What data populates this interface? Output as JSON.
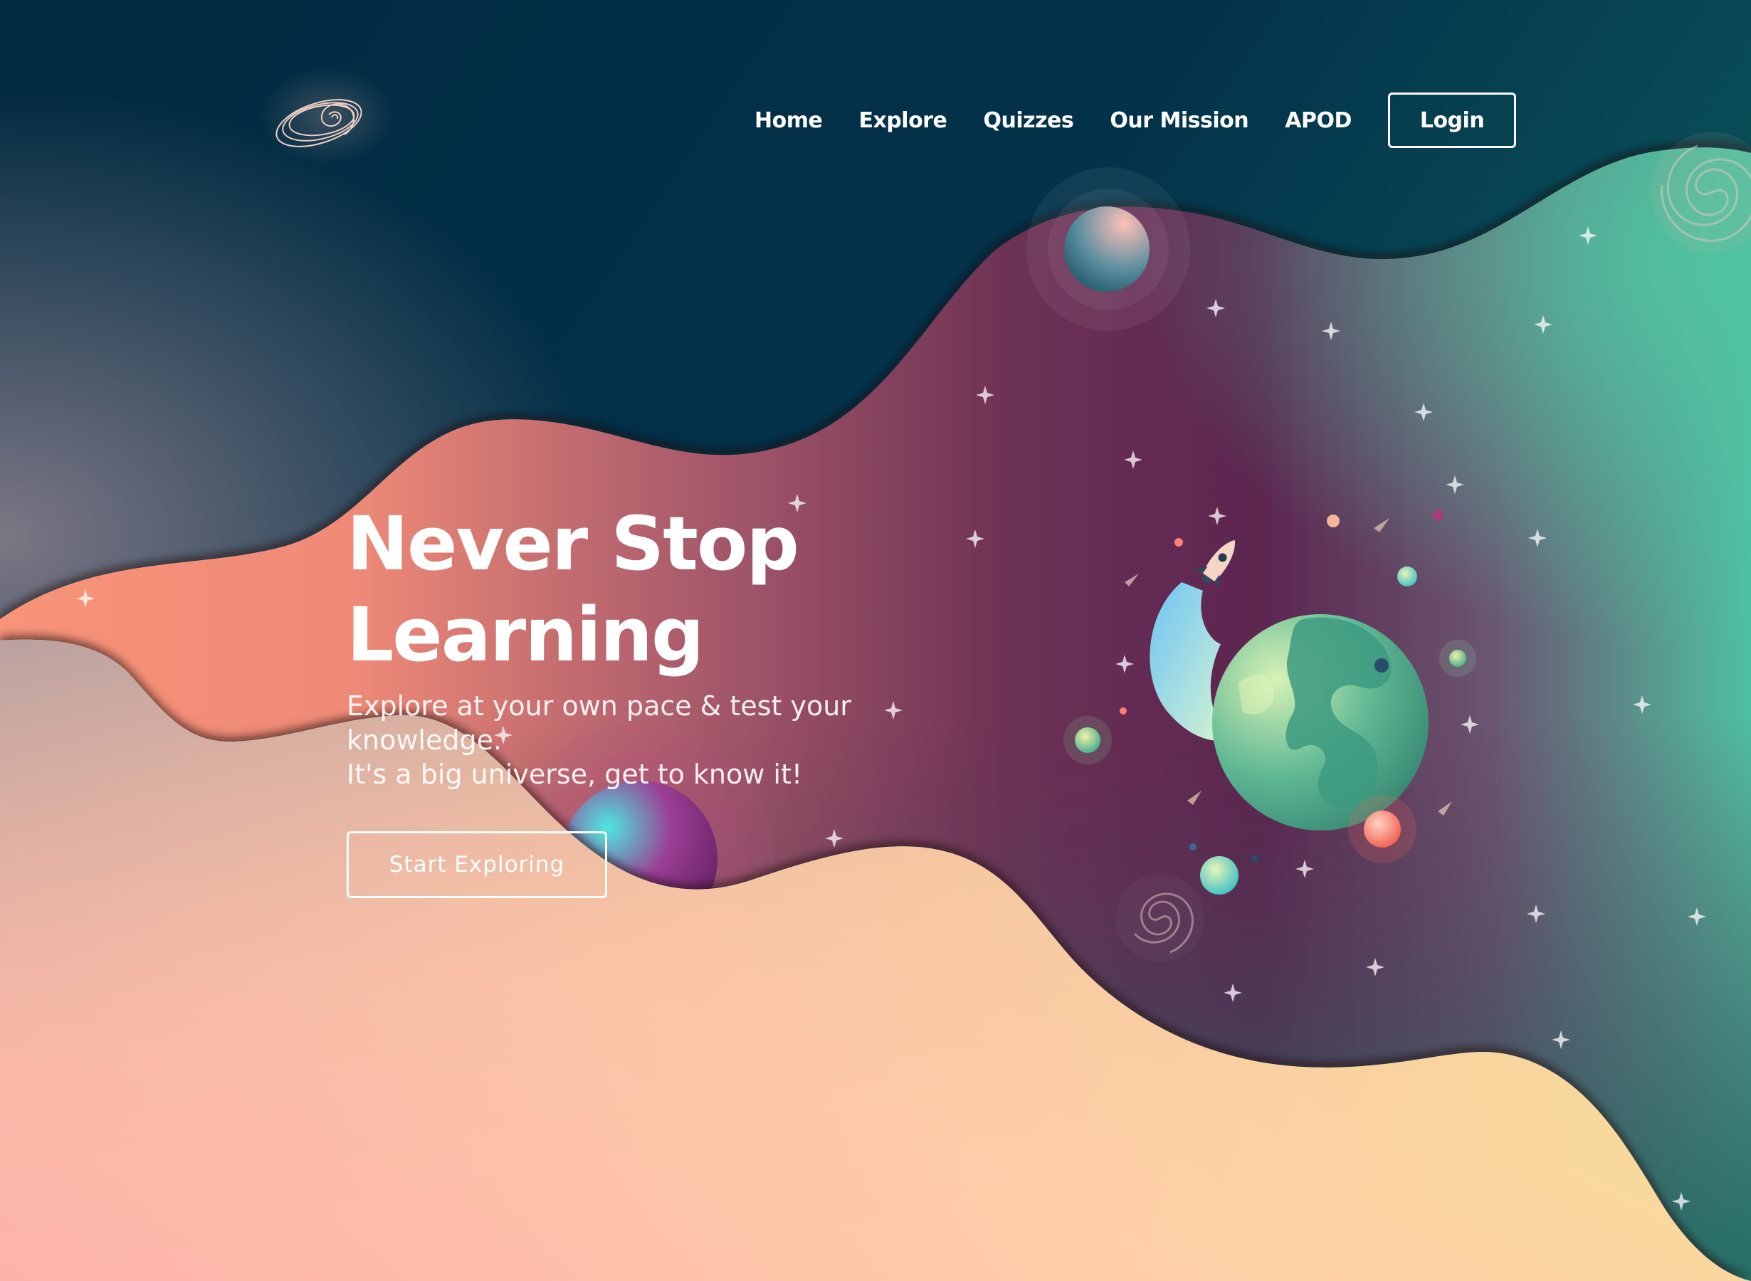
{
  "app": {
    "title": "Never Stop Learning"
  },
  "nav": {
    "items": [
      {
        "label": "Home"
      },
      {
        "label": "Explore"
      },
      {
        "label": "Quizzes"
      },
      {
        "label": "Our Mission"
      },
      {
        "label": "APOD"
      }
    ],
    "login_label": "Login"
  },
  "logo": {
    "icon": "spiral-galaxy-logo-icon"
  },
  "hero": {
    "title_line1": "Never Stop",
    "title_line2": "Learning",
    "subtitle_line1": "Explore at your own pace & test your knowledge.",
    "subtitle_line2": "It's a big universe, get to know it!",
    "cta_label": "Start Exploring"
  },
  "illustration": {
    "icons": [
      "planet-earth-icon",
      "rocket-icon",
      "galaxy-spiral-icon",
      "moon-icon",
      "star-icon"
    ]
  },
  "colors": {
    "deep_space": "#022a40",
    "teal": "#36a48a",
    "salmon": "#f58e79",
    "plum": "#5c2a4e",
    "peach": "#ffcca8",
    "pale_yellow": "#f2e391",
    "text": "#ffffff"
  }
}
